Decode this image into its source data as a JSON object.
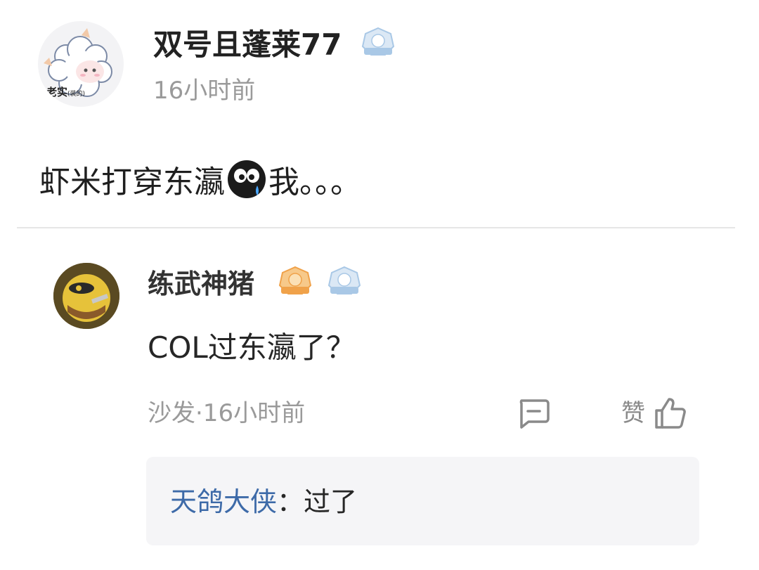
{
  "post": {
    "author": "双号且蓬莱77",
    "avatar_caption": "老实",
    "avatar_caption_small": "(装的)",
    "time": "16小时前",
    "text_before_emoji": "虾米打穿东瀛",
    "emoji": "crying-emoji",
    "text_after_emoji": "我。。。"
  },
  "comment": {
    "author": "练武神猪",
    "text": "COL过东瀛了？",
    "meta": "沙发·16小时前",
    "like_label": "赞",
    "reply": {
      "author": "天鸽大侠",
      "colon": "：",
      "text": "过了"
    }
  },
  "colors": {
    "reply_author": "#3d6aa8",
    "reply_box_bg": "#f5f5f7",
    "badge_blue": "#a9c8e6",
    "badge_orange": "#f0a24a"
  },
  "icons": {
    "reply": "comment-icon",
    "like": "thumbs-up-icon"
  }
}
